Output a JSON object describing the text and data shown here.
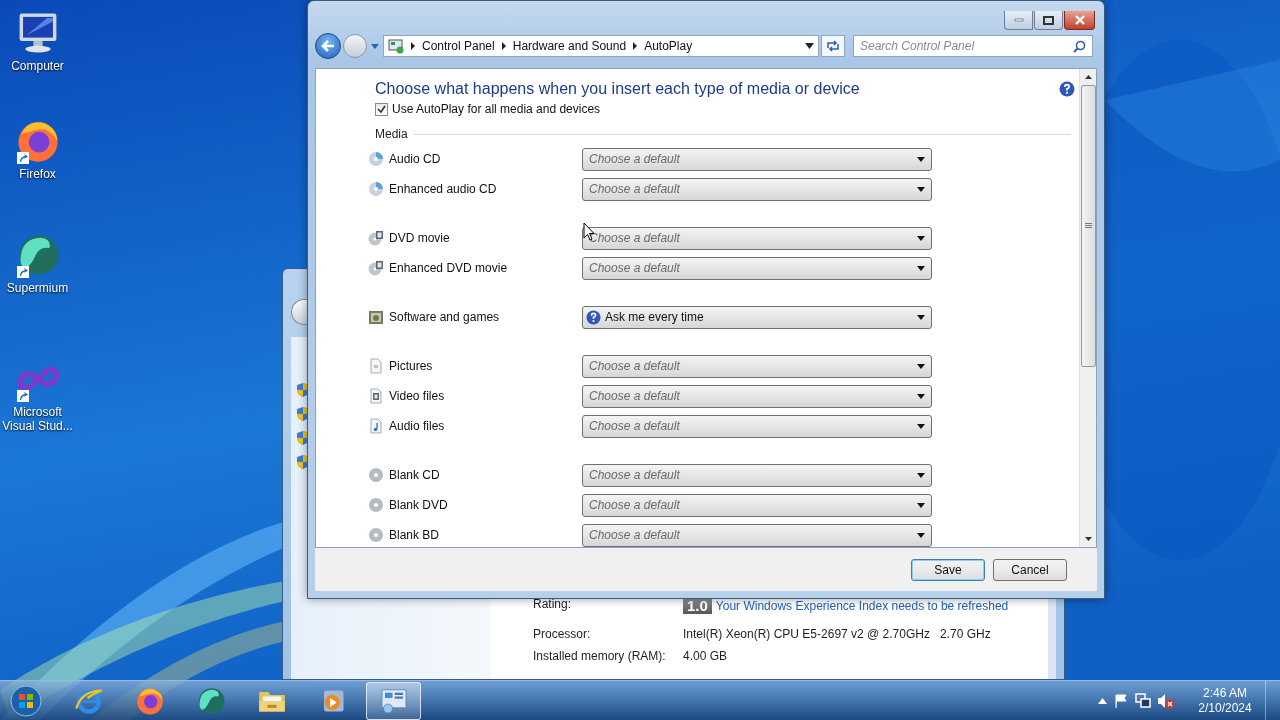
{
  "desktop_icons": [
    {
      "label": "Computer",
      "kind": "computer",
      "shortcut": false
    },
    {
      "label": "Firefox",
      "kind": "firefox",
      "shortcut": true
    },
    {
      "label": "Supermium",
      "kind": "supermium",
      "shortcut": true
    },
    {
      "label": "Microsoft Visual Stud...",
      "kind": "visualstudio",
      "shortcut": true
    }
  ],
  "background_window": {
    "details": [
      {
        "kind": "rating",
        "label": "Rating:",
        "score": "1.0",
        "link": "Your Windows Experience Index needs to be refreshed"
      },
      {
        "kind": "text",
        "label": "Processor:",
        "value": "Intel(R) Xeon(R) CPU E5-2697 v2 @ 2.70GHz   2.70 GHz"
      },
      {
        "kind": "text",
        "label": "Installed memory (RAM):",
        "value": "4.00 GB"
      }
    ]
  },
  "window": {
    "breadcrumbs": [
      "Control Panel",
      "Hardware and Sound",
      "AutoPlay"
    ],
    "search": {
      "placeholder": "Search Control Panel"
    },
    "heading": "Choose what happens when you insert each type of media or device",
    "autoplay_checkbox": {
      "label": "Use AutoPlay for all media and devices",
      "checked": true
    },
    "section": "Media",
    "groups": [
      [
        {
          "label": "Audio CD",
          "kind": "cd",
          "placeholder": "Choose a default"
        },
        {
          "label": "Enhanced audio CD",
          "kind": "cd",
          "placeholder": "Choose a default"
        }
      ],
      [
        {
          "label": "DVD movie",
          "kind": "dvd",
          "placeholder": "Choose a default"
        },
        {
          "label": "Enhanced DVD movie",
          "kind": "dvd",
          "placeholder": "Choose a default"
        }
      ],
      [
        {
          "label": "Software and games",
          "kind": "software",
          "value": "Ask me every time"
        }
      ],
      [
        {
          "label": "Pictures",
          "kind": "picture",
          "placeholder": "Choose a default"
        },
        {
          "label": "Video files",
          "kind": "video",
          "placeholder": "Choose a default"
        },
        {
          "label": "Audio files",
          "kind": "audio",
          "placeholder": "Choose a default"
        }
      ],
      [
        {
          "label": "Blank CD",
          "kind": "blank",
          "placeholder": "Choose a default"
        },
        {
          "label": "Blank DVD",
          "kind": "blank",
          "placeholder": "Choose a default"
        },
        {
          "label": "Blank BD",
          "kind": "blank",
          "placeholder": "Choose a default"
        }
      ]
    ],
    "buttons": [
      {
        "label": "Save",
        "default": true
      },
      {
        "label": "Cancel",
        "default": false
      }
    ]
  },
  "taskbar": {
    "items": [
      {
        "kind": "ie",
        "selected": false
      },
      {
        "kind": "firefox",
        "selected": false
      },
      {
        "kind": "supermium",
        "selected": false
      },
      {
        "kind": "explorer",
        "selected": false
      },
      {
        "kind": "media",
        "selected": false
      },
      {
        "kind": "controlpanel",
        "selected": true
      }
    ],
    "clock": {
      "time": "2:46 AM",
      "date": "2/10/2024"
    }
  }
}
